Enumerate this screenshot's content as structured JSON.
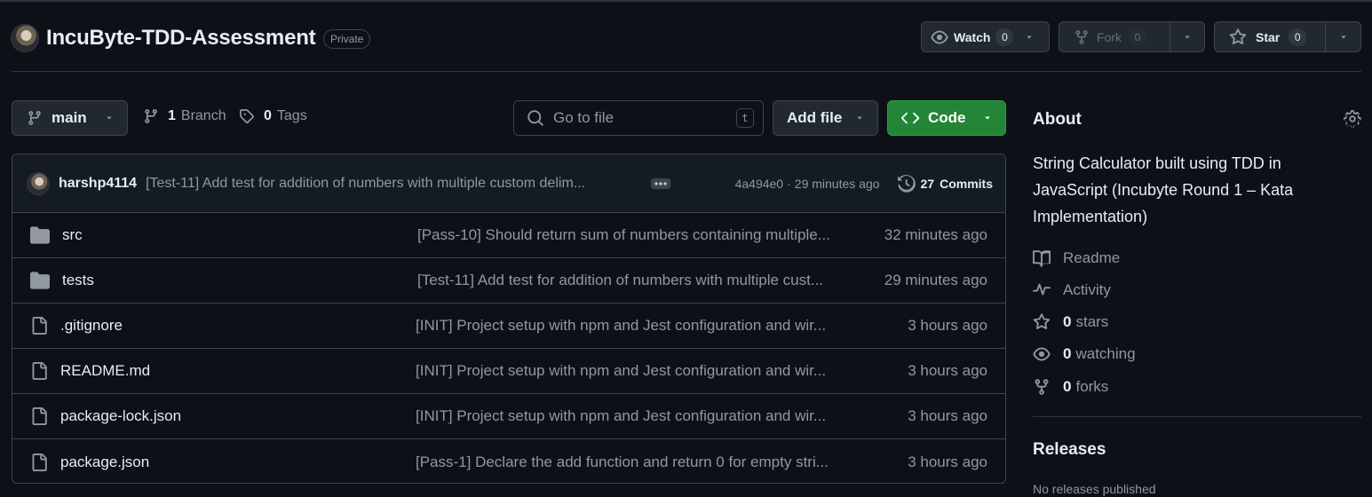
{
  "repo": {
    "name": "IncuByte-TDD-Assessment",
    "visibility": "Private"
  },
  "actions": {
    "watch_label": "Watch",
    "watch_count": "0",
    "fork_label": "Fork",
    "fork_count": "0",
    "star_label": "Star",
    "star_count": "0"
  },
  "toolbar": {
    "branch": "main",
    "branches_count": "1",
    "branches_label": "Branch",
    "tags_count": "0",
    "tags_label": "Tags",
    "search_placeholder": "Go to file",
    "search_shortcut": "t",
    "add_file_label": "Add file",
    "code_label": "Code"
  },
  "latest_commit": {
    "author": "harshp4114",
    "message": "[Test-11] Add test for addition of numbers with multiple custom delim...",
    "hash": "4a494e0",
    "separator": "·",
    "time": "29 minutes ago",
    "commits_count": "27",
    "commits_label": "Commits"
  },
  "files": [
    {
      "type": "folder",
      "name": "src",
      "message": "[Pass-10] Should return sum of numbers containing multiple...",
      "time": "32 minutes ago"
    },
    {
      "type": "folder",
      "name": "tests",
      "message": "[Test-11] Add test for addition of numbers with multiple cust...",
      "time": "29 minutes ago"
    },
    {
      "type": "file",
      "name": ".gitignore",
      "message": "[INIT] Project setup with npm and Jest configuration and wir...",
      "time": "3 hours ago"
    },
    {
      "type": "file",
      "name": "README.md",
      "message": "[INIT] Project setup with npm and Jest configuration and wir...",
      "time": "3 hours ago"
    },
    {
      "type": "file",
      "name": "package-lock.json",
      "message": "[INIT] Project setup with npm and Jest configuration and wir...",
      "time": "3 hours ago"
    },
    {
      "type": "file",
      "name": "package.json",
      "message": "[Pass-1] Declare the add function and return 0 for empty stri...",
      "time": "3 hours ago"
    }
  ],
  "about": {
    "title": "About",
    "description": "String Calculator built using TDD in JavaScript (Incubyte Round 1 – Kata Implementation)",
    "readme_label": "Readme",
    "activity_label": "Activity",
    "stars_count": "0",
    "stars_label": "stars",
    "watching_count": "0",
    "watching_label": "watching",
    "forks_count": "0",
    "forks_label": "forks"
  },
  "releases": {
    "title": "Releases",
    "empty_text": "No releases published"
  },
  "colors": {
    "background": "#0d1117",
    "border": "#3d444d",
    "code_button": "#238636",
    "muted_text": "#9198a1"
  }
}
